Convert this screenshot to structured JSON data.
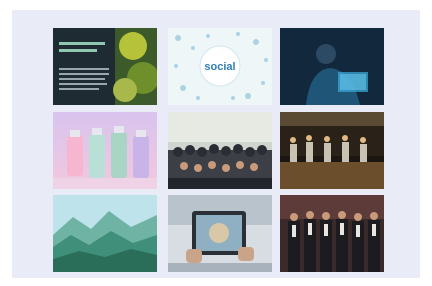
{
  "gallery": {
    "items": [
      {
        "title": "",
        "icon": "report-cover-image"
      },
      {
        "title": "",
        "icon": "social-logo-image",
        "logo_text": "social"
      },
      {
        "title": "",
        "icon": "person-at-computer-image"
      },
      {
        "title": "",
        "icon": "product-bottles-image"
      },
      {
        "title": "",
        "icon": "group-photo-image"
      },
      {
        "title": "",
        "icon": "stage-panel-image"
      },
      {
        "title": "",
        "icon": "mountain-landscape-image"
      },
      {
        "title": "",
        "icon": "tablet-photo-image"
      },
      {
        "title": "",
        "icon": "formal-group-image"
      }
    ]
  }
}
